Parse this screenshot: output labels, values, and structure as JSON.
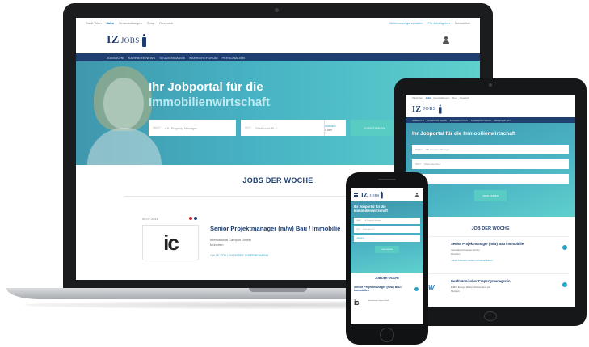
{
  "colors": {
    "brand_navy": "#1e3f6f",
    "accent_teal": "#58cbc3",
    "link_blue": "#28a3c8",
    "badge_red": "#d2232a"
  },
  "topbar": {
    "items": [
      "Stadt Wien",
      "Jobs",
      "Veranstaltungen",
      "Shop",
      "Research"
    ],
    "right_links": [
      "Stellenanzeige schalten",
      "Für Arbeitgeber",
      "Newsletter"
    ]
  },
  "logo": {
    "iz": "IZ",
    "jobs": "JOBS"
  },
  "nav": {
    "items": [
      "JOBSUCHE",
      "KARRIERE NEWS",
      "STUDIENGÄNGE",
      "KARRIEREFORUM",
      "PERSONALIEN"
    ]
  },
  "hero": {
    "title_line1": "Ihr Jobportal für die",
    "title_line2": "Immobilienwirtschaft",
    "title_full": "Ihr Jobportal für die Immobilienwirtschaft",
    "was_tag": "WAS?",
    "was_placeholder": "z.B. Property Manager",
    "wo_tag": "WO?",
    "wo_placeholder": "Stadt oder PLZ",
    "umkreis_label": "UMKREIS",
    "umkreis_value": "5 km",
    "search_button": "JOBS FINDEN"
  },
  "jobs_section": {
    "title": "JOBS DER WOCHE",
    "tablet_title": "JOB DER WOCHE",
    "featured": {
      "date": "06.07.2018",
      "logo_text": "ic",
      "title": "Senior Projektmanager (m/w) Bau / Immobilie",
      "company": "International Campus GmbH",
      "location": "München",
      "link": "+ ALLE STELLEN DIESES UNTERNEHMENS"
    },
    "second": {
      "date": "06.07.2018",
      "logo_text": "EnBW",
      "title": "Kaufmännischer Propertymanager/in",
      "company": "EnBW Energie Baden-Württemberg AG",
      "location": "Stuttgart"
    }
  },
  "phone": {
    "job_title": "Senior Projektmanager (m/w) Bau / Immobilien",
    "company": "International Campus GmbH"
  }
}
